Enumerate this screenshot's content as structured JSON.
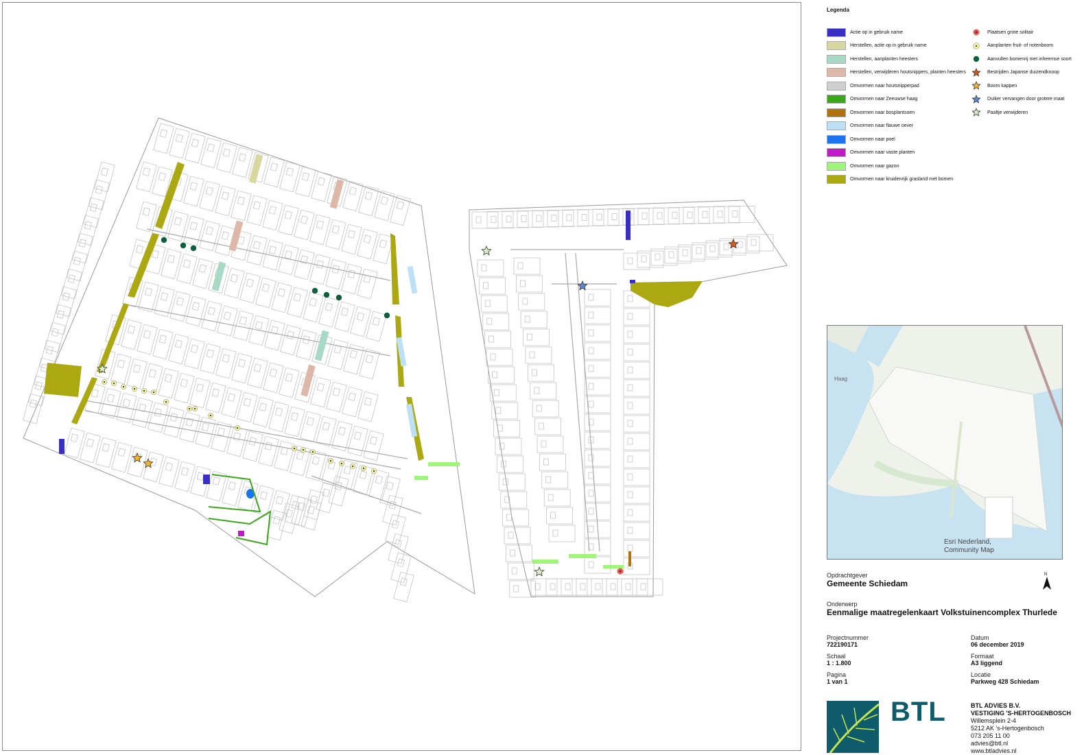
{
  "legend": {
    "title": "Legenda",
    "areas": [
      {
        "label": "Actie op in gebruik name",
        "color": "#3a2fc4"
      },
      {
        "label": "Herstellen, actie op in gebruik name",
        "color": "#d9d7a0"
      },
      {
        "label": "Herstellen, aanplanten heesters",
        "color": "#a7d9c6"
      },
      {
        "label": "Herstellen, verwijderen houtsnippers, planten heesters",
        "color": "#ddb8a8"
      },
      {
        "label": "Omvormen naar houtsnipperpad",
        "color": "#cfcfcf"
      },
      {
        "label": "Omvormen naar Zeeuwse haag",
        "color": "#3aa61a"
      },
      {
        "label": "Omvormen naar bosplantsoen",
        "color": "#b0710f"
      },
      {
        "label": "Omvormen naar flauwe oever",
        "color": "#bde0f4"
      },
      {
        "label": "Omvormen naar poel",
        "color": "#1a74f0"
      },
      {
        "label": "Omvormen naar vaste planten",
        "color": "#c21ac9"
      },
      {
        "label": "Omvormen naar gazon",
        "color": "#9ff57a"
      },
      {
        "label": "Omvormen naar kruidenrijk grasland met bomen",
        "color": "#aba812"
      }
    ],
    "symbols": [
      {
        "label": "Plaatsen grote solitair",
        "icon": "red-circle-dot",
        "color": "#e05a5a"
      },
      {
        "label": "Aanplanten fruit- of notenboom",
        "icon": "yellow-circle-dot",
        "color": "#f2f0a0"
      },
      {
        "label": "Aanvullen bomenrij met inheemse soort",
        "icon": "green-dot",
        "color": "#0f5f3f"
      },
      {
        "label": "Bestrijden Japanse duizendknoop",
        "icon": "star",
        "color": "#d05a20"
      },
      {
        "label": "Boom kappen",
        "icon": "star",
        "color": "#f3b52c"
      },
      {
        "label": "Duiker vervangen door grotere maat",
        "icon": "star",
        "color": "#5c86d6"
      },
      {
        "label": "Paaltje verwijderen",
        "icon": "star",
        "color": "#d7f0c6"
      }
    ]
  },
  "overview": {
    "credit_1": "Esri Nederland,",
    "credit_2": "Community Map"
  },
  "info": {
    "opdrachtgever_label": "Opdrachtgever",
    "opdrachtgever": "Gemeente Schiedam",
    "onderwerp_label": "Onderwerp",
    "onderwerp": "Eenmalige maatregelenkaart Volkstuinencomplex Thurlede",
    "projectnummer_label": "Projectnummer",
    "projectnummer": "722190171",
    "datum_label": "Datum",
    "datum": "06 december 2019",
    "schaal_label": "Schaal",
    "schaal": "1 : 1.800",
    "formaat_label": "Formaat",
    "formaat": "A3 liggend",
    "pagina_label": "Pagina",
    "pagina": "1 van 1",
    "locatie_label": "Locatie",
    "locatie": "Parkweg 428 Schiedam",
    "north_label": "N"
  },
  "company": {
    "logo_text": "BTL",
    "name": "BTL ADVIES B.V.",
    "branch": "VESTIGING 'S-HERTOGENBOSCH",
    "street": "Willemsplein 2-4",
    "city": "5212 AK 's-Hertogenbosch",
    "phone": "073 205 11 00",
    "email": "advies@btl.nl",
    "web": "www.btladvies.nl"
  }
}
